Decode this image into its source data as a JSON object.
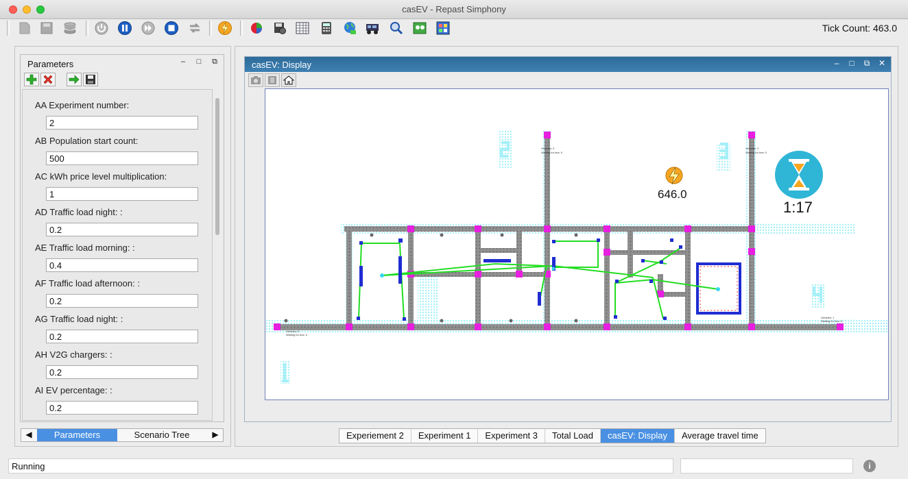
{
  "window": {
    "title": "casEV - Repast Simphony"
  },
  "toolbar": {
    "tick_label": "Tick Count: 463.0",
    "buttons": [
      "save-project-icon",
      "save-icon",
      "database-icon",
      "init-icon",
      "pause-icon",
      "step-icon",
      "stop-icon",
      "reset-icon",
      "run-icon",
      "chart-icon",
      "settings-icon",
      "grid-icon",
      "calculator-icon",
      "globe-icon",
      "batch-icon",
      "search-icon",
      "image-icon",
      "model-icon"
    ]
  },
  "parameters": {
    "title": "Parameters",
    "items": [
      {
        "label": "AA Experiment number:",
        "value": "2"
      },
      {
        "label": "AB Population start count:",
        "value": "500"
      },
      {
        "label": "AC kWh price level multiplication:",
        "value": "1"
      },
      {
        "label": "AD Traffic load night: :",
        "value": "0.2"
      },
      {
        "label": "AE Traffic load morning: :",
        "value": "0.4"
      },
      {
        "label": "AF Traffic load afternoon: :",
        "value": "0.2"
      },
      {
        "label": "AG Traffic load night: :",
        "value": "0.2"
      },
      {
        "label": "AH V2G chargers: :",
        "value": "0.2"
      },
      {
        "label": "AI EV percentage: :",
        "value": "0.2"
      }
    ]
  },
  "left_tabs": {
    "active": "Parameters",
    "other": "Scenario Tree"
  },
  "display": {
    "title": "casEV: Display",
    "energy_value": "646.0",
    "time_value": "1:17"
  },
  "bottom_tabs": [
    "Experiement 2",
    "Experiment 1",
    "Experiment 3",
    "Total Load",
    "casEV: Display",
    "Average travel time"
  ],
  "bottom_tabs_active": "casEV: Display",
  "status": {
    "text": "Running"
  },
  "colors": {
    "accent": "#4a90e2",
    "title_bar": "#3574a6",
    "road": "#8f8f8f",
    "intersection": "#e81ee0",
    "route": "#22dd22",
    "ev": "#1f2dd1",
    "hourglass": "#2fb5d6"
  }
}
